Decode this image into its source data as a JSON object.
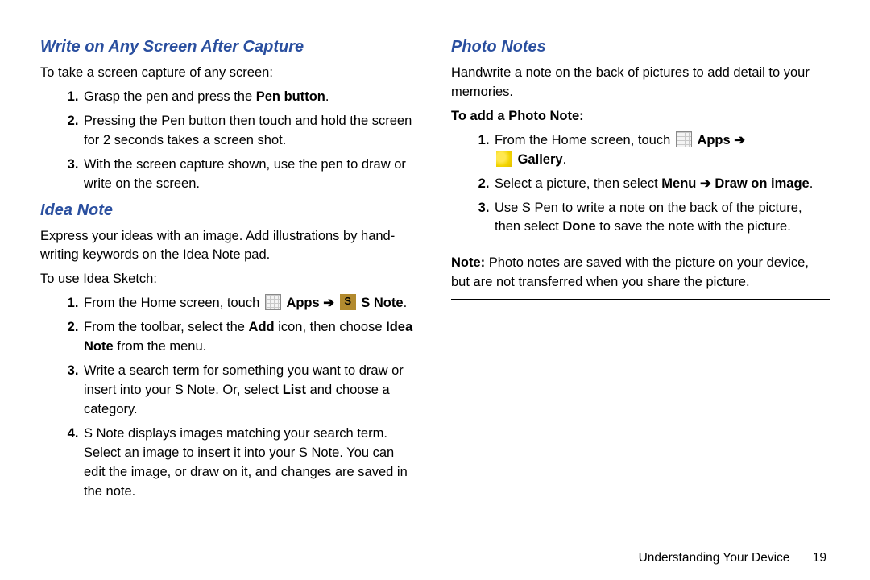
{
  "left_col": {
    "section1": {
      "title": "Write on Any Screen After Capture",
      "intro": "To take a screen capture of any screen:",
      "steps": {
        "s1_a": "Grasp the pen and press the ",
        "s1_b": "Pen button",
        "s1_c": ".",
        "s2": "Pressing the Pen button then touch and hold the screen for 2 seconds takes a screen shot.",
        "s3": "With the screen capture shown, use the pen to draw or write on the screen."
      }
    },
    "section2": {
      "title": "Idea Note",
      "intro": "Express your ideas with an image. Add illustrations by hand-writing keywords on the Idea Note pad.",
      "use_line": "To use Idea Sketch:",
      "steps": {
        "s1_a": "From the Home screen, touch ",
        "s1_apps": " Apps ",
        "s1_arrow": "➔",
        "s1_snote": " S Note",
        "s1_dot": ".",
        "s2_a": "From the toolbar, select the ",
        "s2_b": "Add",
        "s2_c": " icon, then choose ",
        "s2_d": "Idea Note",
        "s2_e": " from the menu.",
        "s3_a": "Write a search term for something you want to draw or insert into your S Note. Or, select ",
        "s3_b": "List",
        "s3_c": " and choose a category.",
        "s4": "S Note displays images matching your search term. Select an image to insert it into your S Note. You can edit the image, or draw on it, and changes are saved in the note."
      }
    }
  },
  "right_col": {
    "section1": {
      "title": "Photo Notes",
      "intro": "Handwrite a note on the back of pictures to add detail to your memories.",
      "sub_label": "To add a Photo Note:",
      "steps": {
        "s1_a": "From the Home screen, touch ",
        "s1_apps": " Apps ",
        "s1_arrow": "➔",
        "s1_gallery": " Gallery",
        "s1_dot": ".",
        "s2_a": "Select a picture, then select ",
        "s2_b": "Menu ",
        "s2_arrow": "➔",
        "s2_c": " Draw on image",
        "s2_d": ".",
        "s3_a": "Use S Pen to write a note on the back of the picture, then select ",
        "s3_b": "Done",
        "s3_c": " to save the note with the picture."
      },
      "note": {
        "label": "Note:",
        "text": " Photo notes are saved with the picture on your device, but are not transferred when you share the picture."
      }
    }
  },
  "footer": {
    "chapter": "Understanding Your Device",
    "page": "19"
  }
}
